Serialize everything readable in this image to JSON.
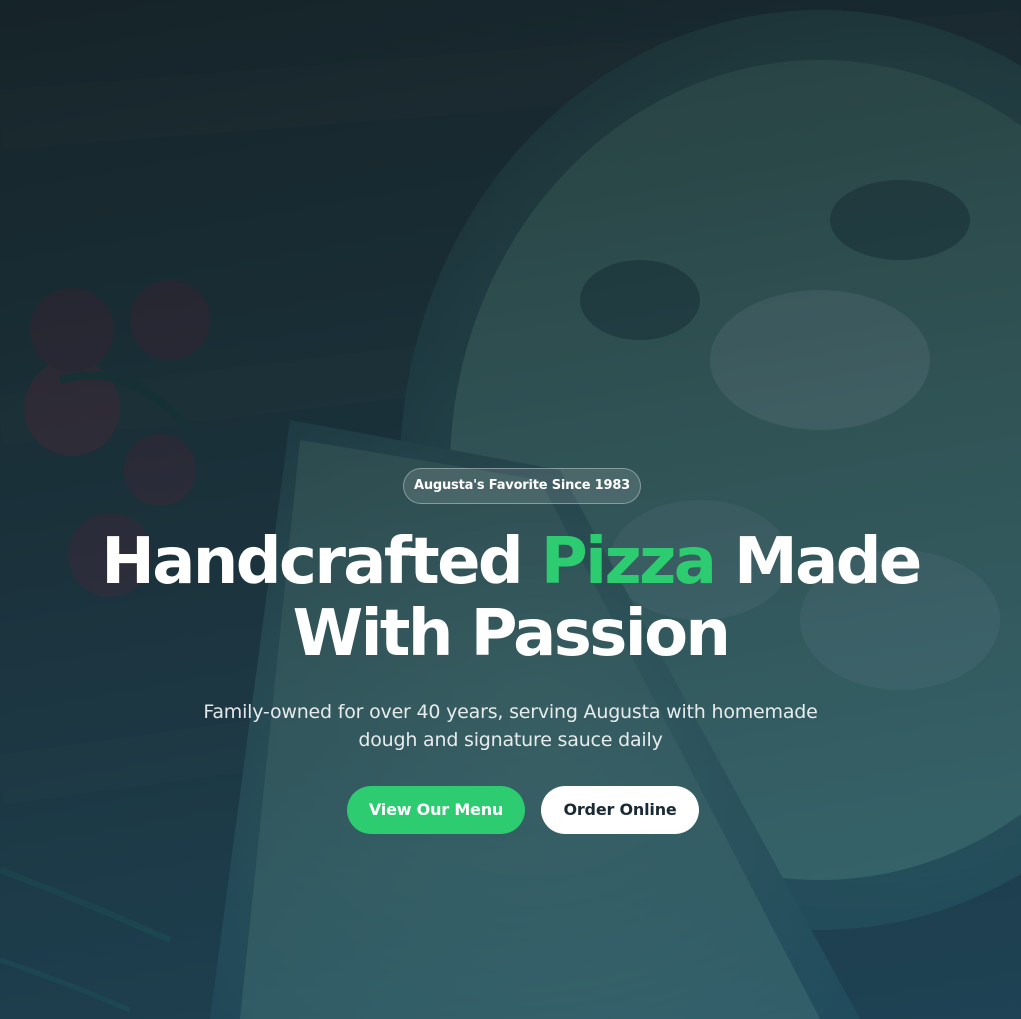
{
  "hero": {
    "badge": "Augusta's Favorite Since 1983",
    "headline": {
      "part1": "Handcrafted ",
      "accent": "Pizza",
      "part2": " Made",
      "line2": "With Passion"
    },
    "subtext_line1": "Family-owned for over 40 years, serving Augusta with homemade",
    "subtext_line2": "dough and signature sauce daily",
    "primary_button": "View Our Menu",
    "secondary_button": "Order Online"
  },
  "colors": {
    "accent": "#2ecc71",
    "overlay": "#0e3450",
    "button_secondary_bg": "#ffffff",
    "button_secondary_text": "#1a2a35"
  }
}
